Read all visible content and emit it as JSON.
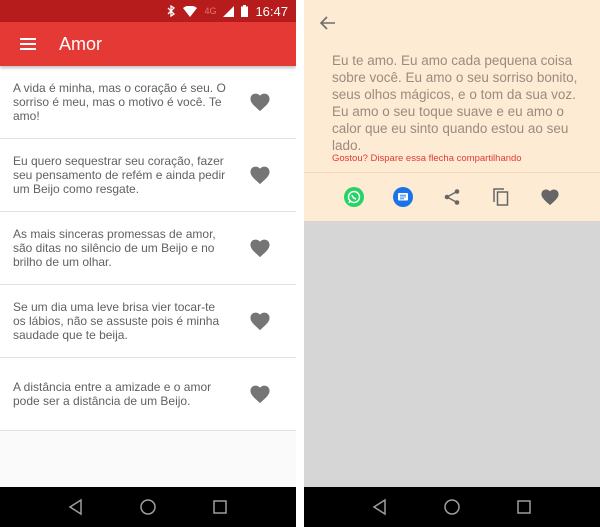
{
  "status_bar": {
    "time": "16:47",
    "network": "4G",
    "icons": [
      "bluetooth-icon",
      "wifi-icon",
      "signal-icon",
      "battery-icon"
    ]
  },
  "left_screen": {
    "app_bar": {
      "title": "Amor",
      "menu_icon": "menu-icon"
    },
    "quotes": [
      {
        "text": "A vida é minha, mas o coração é seu. O sorriso é meu, mas o motivo é você. Te amo!",
        "icon": "heart-icon"
      },
      {
        "text": "Eu quero sequestrar seu coração, fazer seu pensamento de refém e ainda pedir um Beijo como resgate.",
        "icon": "heart-icon"
      },
      {
        "text": "As mais sinceras promessas de amor, são ditas no silêncio de um Beijo e no brilho de um olhar.",
        "icon": "heart-icon"
      },
      {
        "text": "Se um dia uma leve brisa vier tocar-te os lábios, não se assuste pois é minha saudade que te beija.",
        "icon": "heart-icon"
      },
      {
        "text": "A distância entre a amizade e o amor pode ser a distância de um Beijo.",
        "icon": "heart-icon"
      }
    ]
  },
  "right_screen": {
    "back_icon": "arrow-back-icon",
    "quote": "Eu te amo. Eu amo cada pequena coisa sobre você. Eu amo o seu sorriso bonito, seus olhos mágicos, e o tom da sua voz. Eu amo o seu toque suave e eu amo o calor que eu sinto quando estou ao seu lado.",
    "cta": "Gostou? Dispare essa flecha compartilhando",
    "actions": [
      "whatsapp-icon",
      "messages-icon",
      "share-icon",
      "copy-icon",
      "heart-icon"
    ]
  },
  "nav_bar": {
    "buttons": [
      "back",
      "home",
      "recents"
    ]
  },
  "colors": {
    "primary": "#e53935",
    "primary_dark": "#b71c1c",
    "card_bg": "#fdebd3",
    "quote_text": "#a1887f",
    "whatsapp": "#25d366",
    "messages": "#1a73e8"
  }
}
